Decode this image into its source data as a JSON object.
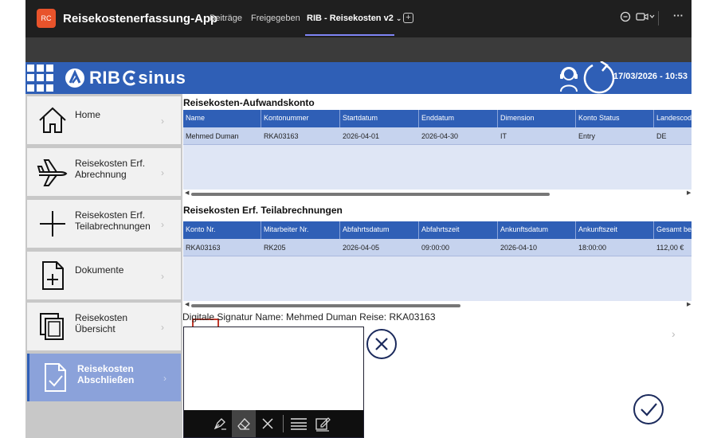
{
  "teams": {
    "app_icon_text": "RC",
    "app_title": "Reisekostenerfassung-App",
    "tabs": [
      {
        "label": "Beiträge"
      },
      {
        "label": "Freigegeben"
      },
      {
        "label": "RIB - Reisekosten v2"
      }
    ],
    "more_label": "···"
  },
  "header": {
    "logo_text": "RIB",
    "logo_text2": "sinus",
    "datetime": "17/03/2026 - 10:53"
  },
  "sidebar": {
    "items": [
      {
        "label1": "Home",
        "label2": "",
        "icon": "home-icon"
      },
      {
        "label1": "Reisekosten Erf.",
        "label2": "Abrechnung",
        "icon": "airplane-icon"
      },
      {
        "label1": "Reisekosten Erf.",
        "label2": "Teilabrechnungen",
        "icon": "plus-icon"
      },
      {
        "label1": "Dokumente",
        "label2": "",
        "icon": "document-plus-icon"
      },
      {
        "label1": "Reisekosten",
        "label2": "Übersicht",
        "icon": "copy-icon"
      },
      {
        "label1": "Reisekosten",
        "label2": "Abschließen",
        "icon": "document-check-icon"
      }
    ]
  },
  "table1": {
    "title": "Reisekosten-Aufwandskonto",
    "columns": [
      "Name",
      "Kontonummer",
      "Startdatum",
      "Enddatum",
      "Dimension",
      "Konto Status",
      "Landescode"
    ],
    "rows": [
      [
        "Mehmed Duman",
        "RKA03163",
        "2026-04-01",
        "2026-04-30",
        "IT",
        "Entry",
        "DE"
      ]
    ]
  },
  "table2": {
    "title": "Reisekosten Erf. Teilabrechnungen",
    "columns": [
      "Konto Nr.",
      "Mitarbeiter Nr.",
      "Abfahrtsdatum",
      "Abfahrtszeit",
      "Ankunftsdatum",
      "Ankunftszeit",
      "Gesamt bez"
    ],
    "rows": [
      [
        "RKA03163",
        "RK205",
        "2026-04-05",
        "09:00:00",
        "2026-04-10",
        "18:00:00",
        "112,00 €"
      ]
    ]
  },
  "signature": {
    "label": "Digitale Signatur Name: Mehmed Duman Reise: RKA03163"
  },
  "colors": {
    "brand_blue": "#2f5fb6",
    "active_nav": "#8ba2da",
    "teams_bar": "#1f1f1f"
  }
}
